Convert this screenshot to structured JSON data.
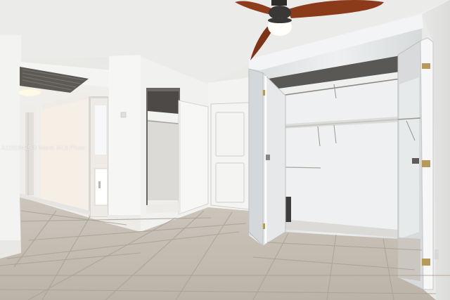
{
  "photo": {
    "watermark": "A11619429 © Miami MLS Photo",
    "colors": {
      "ceiling": "#ececea",
      "wall": "#f1f1ef",
      "floor_tile": "#c4bcb2",
      "grout": "#b2aaa0",
      "fan_blade": "#8e3d1c",
      "mirror": "#e4e6e7"
    }
  }
}
